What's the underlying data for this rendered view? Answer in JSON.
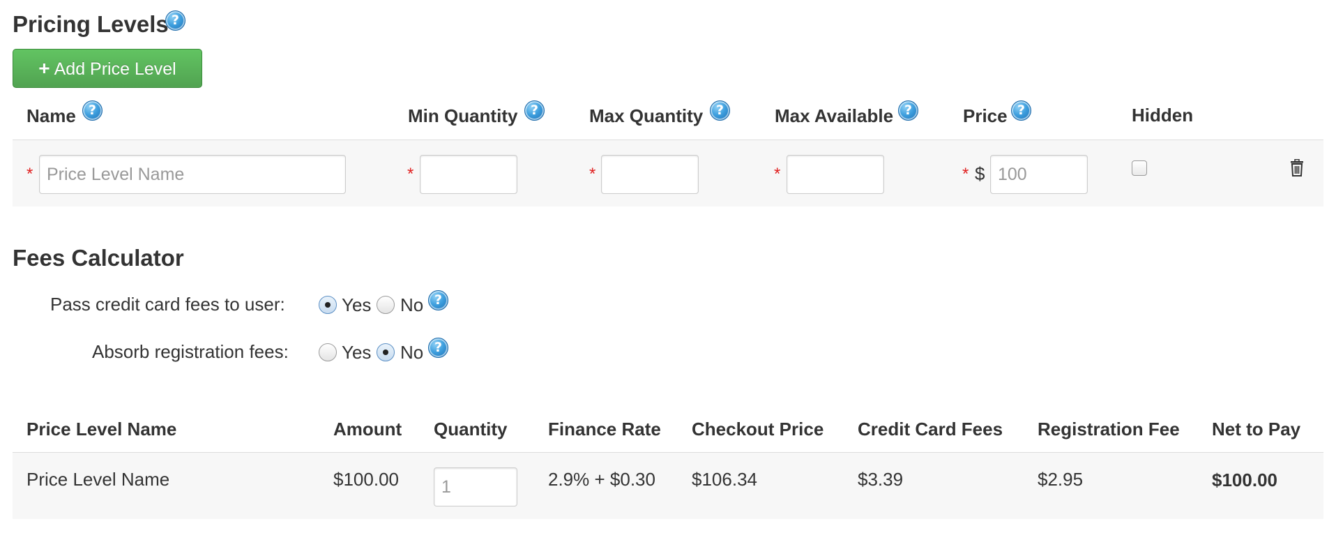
{
  "pricing": {
    "title": "Pricing Levels",
    "add_button_label": "Add Price Level",
    "columns": {
      "name": "Name",
      "min_quantity": "Min Quantity",
      "max_quantity": "Max Quantity",
      "max_available": "Max Available",
      "price": "Price",
      "hidden": "Hidden"
    },
    "row": {
      "required_mark": "*",
      "name_placeholder": "Price Level Name",
      "currency_symbol": "$",
      "price_placeholder": "100"
    }
  },
  "fees": {
    "title": "Fees Calculator",
    "pass_cc_label": "Pass credit card fees to user:",
    "absorb_label": "Absorb registration fees:",
    "yes": "Yes",
    "no": "No",
    "pass_cc_selected": "Yes",
    "absorb_selected": "No"
  },
  "summary": {
    "headers": [
      "Price Level Name",
      "Amount",
      "Quantity",
      "Finance Rate",
      "Checkout Price",
      "Credit Card Fees",
      "Registration Fee",
      "Net to Pay"
    ],
    "row": {
      "name": "Price Level Name",
      "amount": "$100.00",
      "quantity_placeholder": "1",
      "finance_rate": "2.9% + $0.30",
      "checkout_price": "$106.34",
      "credit_card_fees": "$3.39",
      "registration_fee": "$2.95",
      "net_to_pay": "$100.00"
    }
  },
  "icons": {
    "help": "question-mark-help-icon",
    "add": "plus-icon",
    "delete": "trash-icon"
  },
  "colors": {
    "accent_green": "#5bb75b",
    "required_red": "#e02020",
    "help_blue": "#3e9fde"
  }
}
